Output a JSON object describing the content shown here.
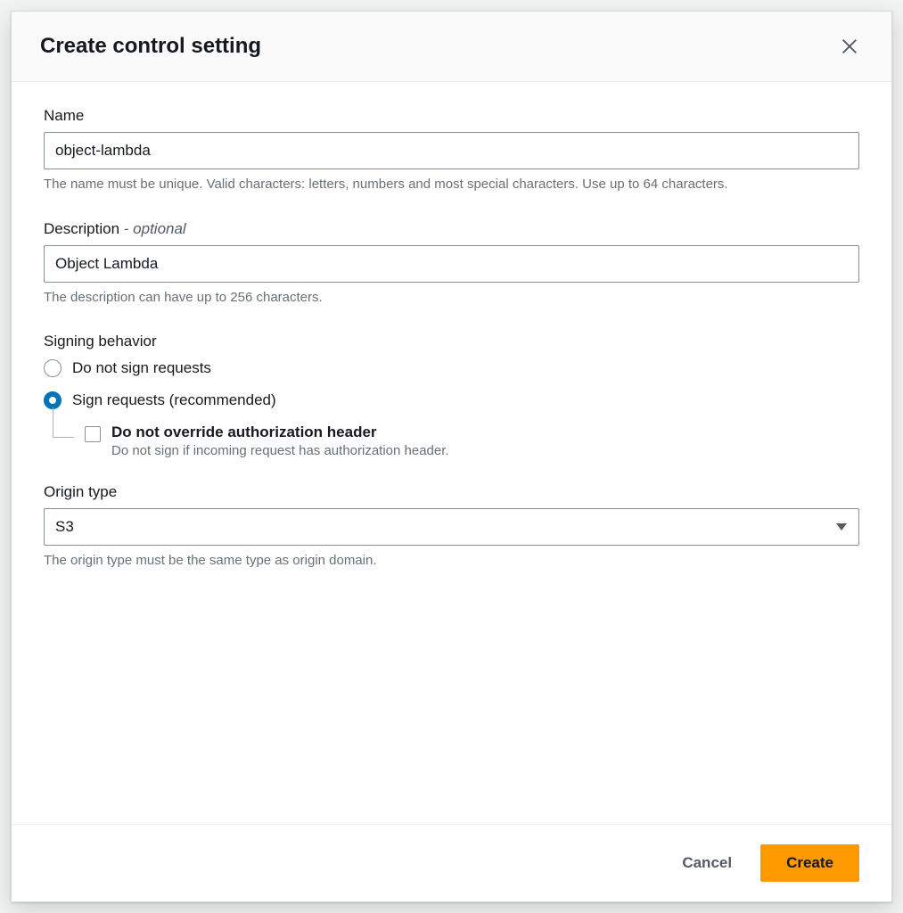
{
  "modal": {
    "title": "Create control setting",
    "name": {
      "label": "Name",
      "value": "object-lambda",
      "help": "The name must be unique. Valid characters: letters, numbers and most special characters. Use up to 64 characters."
    },
    "description": {
      "label": "Description",
      "optional_suffix": " - optional",
      "value": "Object Lambda",
      "help": "The description can have up to 256 characters."
    },
    "signing": {
      "label": "Signing behavior",
      "options": {
        "no_sign": "Do not sign requests",
        "sign": "Sign requests (recommended)"
      },
      "override": {
        "label": "Do not override authorization header",
        "desc": "Do not sign if incoming request has authorization header."
      }
    },
    "origin_type": {
      "label": "Origin type",
      "value": "S3",
      "help": "The origin type must be the same type as origin domain."
    },
    "footer": {
      "cancel": "Cancel",
      "create": "Create"
    }
  }
}
